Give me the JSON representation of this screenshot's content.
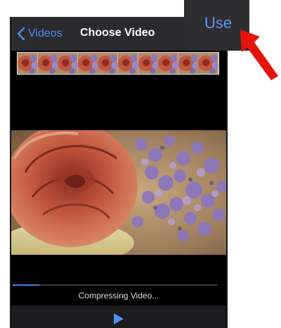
{
  "nav": {
    "back_label": "Videos",
    "title": "Choose Video",
    "use_label": "Use"
  },
  "player": {
    "status_text": "Compressing Video...",
    "progress": 0.13,
    "filmstrip_frames": 10
  },
  "icons": {
    "back": "chevron-left-icon",
    "play": "play-icon",
    "annotation": "red-arrow-icon"
  },
  "colors": {
    "accent": "#4a90f0",
    "annotation": "#e8140c",
    "nav_background": "#2b2b2d"
  }
}
